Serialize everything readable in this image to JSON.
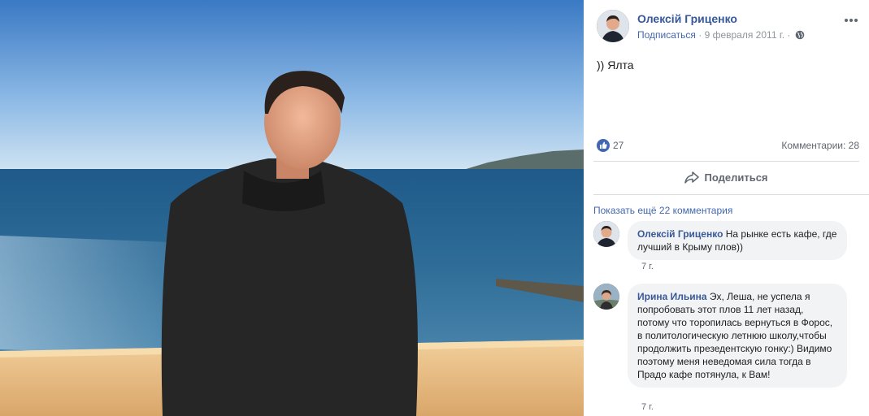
{
  "post": {
    "author": "Олексій Гриценко",
    "subscribe": "Подписаться",
    "date": " · 9 февраля 2011 г. · ",
    "text": ")) Ялта",
    "likes": "27",
    "comments_label": "Комментарии: 28",
    "share_label": "Поделиться"
  },
  "comments": {
    "show_more": "Показать ещё 22 комментария",
    "items": [
      {
        "name": "Олексій Гриценко",
        "text": " На рынке есть кафе, где лучший в Крыму плов))",
        "time": "7 г."
      },
      {
        "name": "Ирина Ильина",
        "text": " Эх, Леша, не успела я попробовать этот плов 11 лет назад, потому что торопилась вернуться в Форос, в политологическую летнюю школу,чтобы продолжить презедентскую гонку:) Видимо поэтому меня неведомая сила тогда в Прадо кафе потянула, к Вам!",
        "time": "7 г."
      }
    ]
  },
  "icons": {
    "globe": "globe-icon",
    "more": "more-options-icon",
    "like": "like-thumb-icon",
    "share": "share-arrow-icon"
  },
  "colors": {
    "link": "#365899",
    "accent": "#4267b2",
    "muted": "#90949c",
    "bubble": "#f2f3f5"
  }
}
